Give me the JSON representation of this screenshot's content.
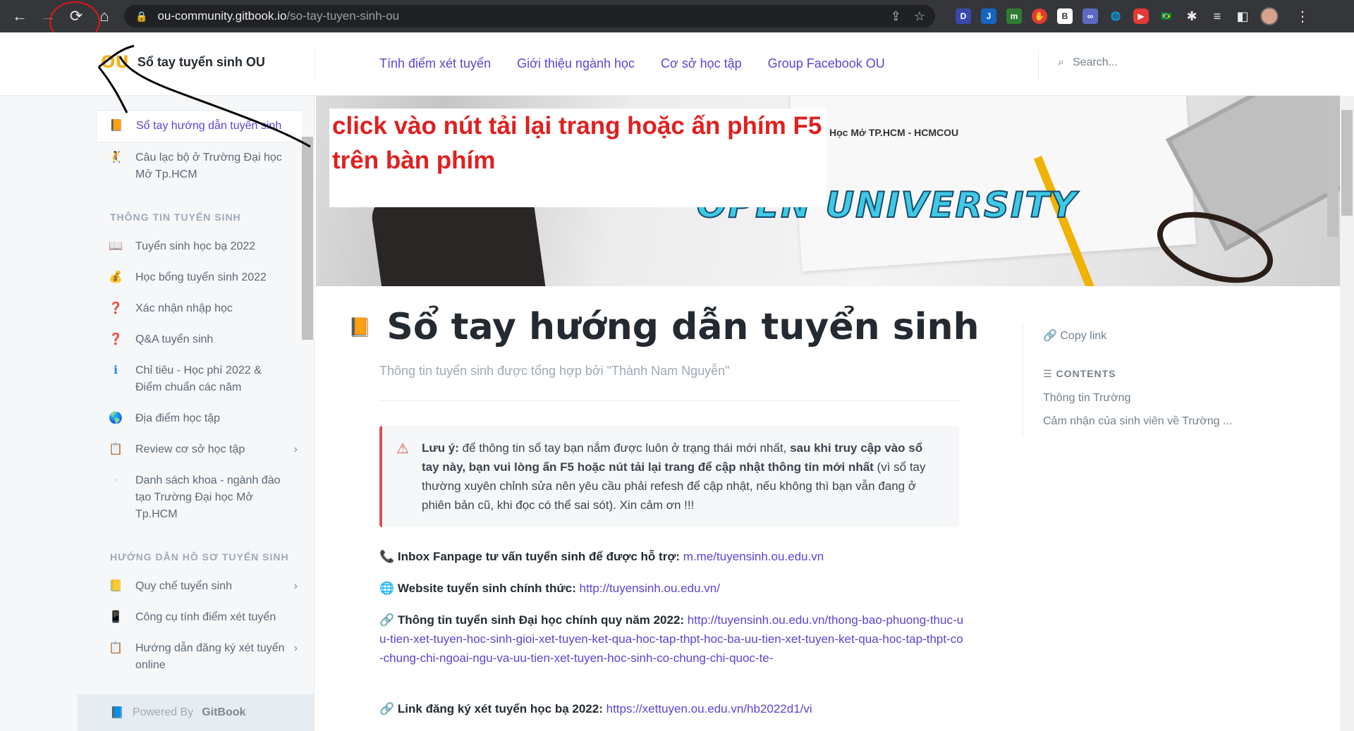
{
  "browser": {
    "url_host": "ou-community.gitbook.io",
    "url_path": "/so-tay-tuyen-sinh-ou",
    "extensions": [
      "D",
      "J",
      "m",
      "B"
    ]
  },
  "site": {
    "brand_logo": "OU",
    "brand_name": "Sổ tay tuyển sinh OU",
    "top_links": [
      "Tính điểm xét tuyển",
      "Giới thiệu ngành học",
      "Cơ sở học tập",
      "Group Facebook OU"
    ],
    "search_placeholder": "Search..."
  },
  "sidebar": {
    "items_top": [
      {
        "icon": "📙",
        "label": "Sổ tay hướng dẫn tuyển sinh",
        "active": true
      },
      {
        "icon": "🤾",
        "label": "Câu lạc bộ ở Trường Đại học Mở Tp.HCM"
      }
    ],
    "section1": "THÔNG TIN TUYỂN SINH",
    "items_s1": [
      {
        "icon": "📖",
        "label": "Tuyển sinh học bạ 2022"
      },
      {
        "icon": "💰",
        "label": "Học bổng tuyển sinh 2022"
      },
      {
        "icon": "❓",
        "label": "Xác nhận nhập học"
      },
      {
        "icon": "❓",
        "label": "Q&A tuyển sinh"
      },
      {
        "icon": "ℹ",
        "label": "Chỉ tiêu - Học phí 2022 & Điểm chuẩn các năm"
      },
      {
        "icon": "🌎",
        "label": "Địa điểm học tập"
      },
      {
        "icon": "📋",
        "label": "Review cơ sở học tập",
        "chevron": true
      },
      {
        "icon": "▫",
        "label": "Danh sách khoa - ngành đào tạo Trường Đại học Mở Tp.HCM"
      }
    ],
    "section2": "HƯỚNG DẪN HỒ SƠ TUYỂN SINH",
    "items_s2": [
      {
        "icon": "📒",
        "label": "Quy chế tuyển sinh",
        "chevron": true
      },
      {
        "icon": "📱",
        "label": "Công cụ tính điểm xét tuyển"
      },
      {
        "icon": "📋",
        "label": "Hướng dẫn đăng ký xét tuyển online",
        "chevron": true
      }
    ],
    "powered_prefix": "Powered By",
    "powered_brand": "GitBook"
  },
  "hero": {
    "school": "Học Mở TP.HCM - HCMCOU",
    "title": "OPEN UNIVERSITY"
  },
  "annotation": {
    "text": "click vào nút tải lại trang hoặc ấn phím F5 trên bàn phím"
  },
  "page": {
    "title_icon": "📙",
    "title": "Sổ tay hướng dẫn tuyển sinh",
    "subtitle": "Thông tin tuyển sinh được tổng hợp bởi \"Thành Nam Nguyễn\"",
    "hint_bold1": "Lưu ý:",
    "hint_text1": " để thông tin sổ tay bạn nắm được luôn ở trạng thái mới nhất, ",
    "hint_bold2": "sau khi truy cập vào sổ tay này, bạn vui lòng ấn F5 hoặc nút tải lại trang để cập nhật thông tin mới nhất",
    "hint_text2": " (vì sổ tay thường xuyên chỉnh sửa nên yêu cầu phải refesh để cập nhật, nếu không thì bạn vẫn đang ở phiên bản cũ, khi đọc có thể sai sót). Xin cảm ơn !!!",
    "p1_icon": "📞",
    "p1_label": "Inbox Fanpage tư vấn tuyển sinh để được hỗ trợ:",
    "p1_link": "m.me/tuyensinh.ou.edu.vn",
    "p2_icon": "🌐",
    "p2_label": "Website tuyển sinh chính thức:",
    "p2_link": "http://tuyensinh.ou.edu.vn/",
    "p3_icon": "🔗",
    "p3_label": "Thông tin tuyển sinh Đại học chính quy năm 2022:",
    "p3_link": "http://tuyensinh.ou.edu.vn/thong-bao-phuong-thuc-uu-tien-xet-tuyen-hoc-sinh-gioi-xet-tuyen-ket-qua-hoc-tap-thpt-hoc-ba-uu-tien-xet-tuyen-ket-qua-hoc-tap-thpt-co-chung-chi-ngoai-ngu-va-uu-tien-xet-tuyen-hoc-sinh-co-chung-chi-quoc-te-",
    "p4_icon": "🔗",
    "p4_label": "Link đăng ký xét tuyển học bạ 2022:",
    "p4_link": "https://xettuyen.ou.edu.vn/hb2022d1/vi"
  },
  "toc": {
    "copy_link": "Copy link",
    "heading": "CONTENTS",
    "items": [
      "Thông tin Trường",
      "Cảm nhận của sinh viên về Trường ..."
    ]
  }
}
